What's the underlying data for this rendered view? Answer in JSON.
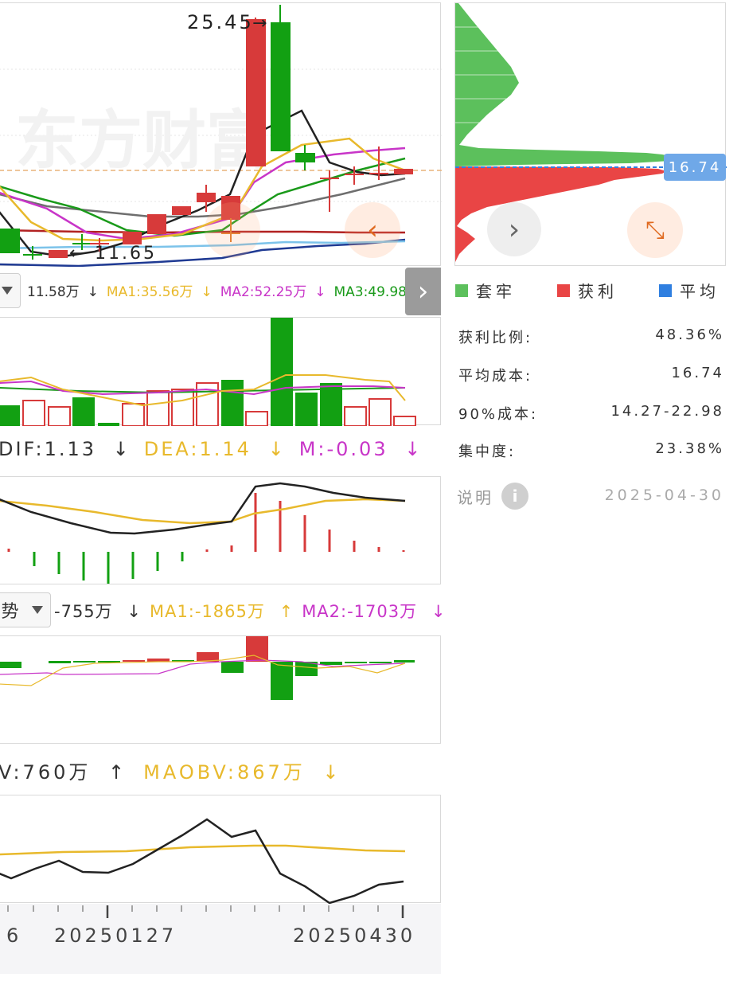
{
  "kline": {
    "high_label": "25.45",
    "low_label": "11.65",
    "watermark": "东方财富",
    "price_line_color": "#e9b37a"
  },
  "vol_legend": {
    "vol": "11.58万",
    "ma1": "MA1:35.56万",
    "ma2": "MA2:52.25万",
    "ma3": "MA3:49.98万"
  },
  "macd_legend": {
    "dif": "DIF:1.13",
    "dea": "DEA:1.14",
    "m": "M:-0.03"
  },
  "zjqs_legend": {
    "name": "势",
    "val": "-755万",
    "ma1": "MA1:-1865万",
    "ma2": "MA2:-1703万"
  },
  "obv_legend": {
    "obv": "V:760万",
    "maobv": "MAOBV:867万"
  },
  "x_axis": {
    "left_partial": "6",
    "date1": "20250127",
    "date2": "20250430"
  },
  "chip": {
    "price_tag": "16.74",
    "legend": {
      "trapped": "套牢",
      "profit": "获利",
      "average": "平均"
    },
    "stats": [
      {
        "label": "获利比例:",
        "value": "48.36%"
      },
      {
        "label": "平均成本:",
        "value": "16.74"
      },
      {
        "label": "90%成本:",
        "value": "14.27-22.98"
      },
      {
        "label": "集中度:",
        "value": "23.38%"
      }
    ],
    "note_label": "说明",
    "date": "2025-04-30"
  },
  "colors": {
    "up": "#d73a3a",
    "down": "#12a012",
    "ma_yellow": "#e8b92c",
    "ma_magenta": "#c835c8",
    "ma_green": "#1a9a1a",
    "chip_green": "#5cc05c",
    "chip_red": "#e94545",
    "chip_blue": "#2f7fe0"
  }
}
